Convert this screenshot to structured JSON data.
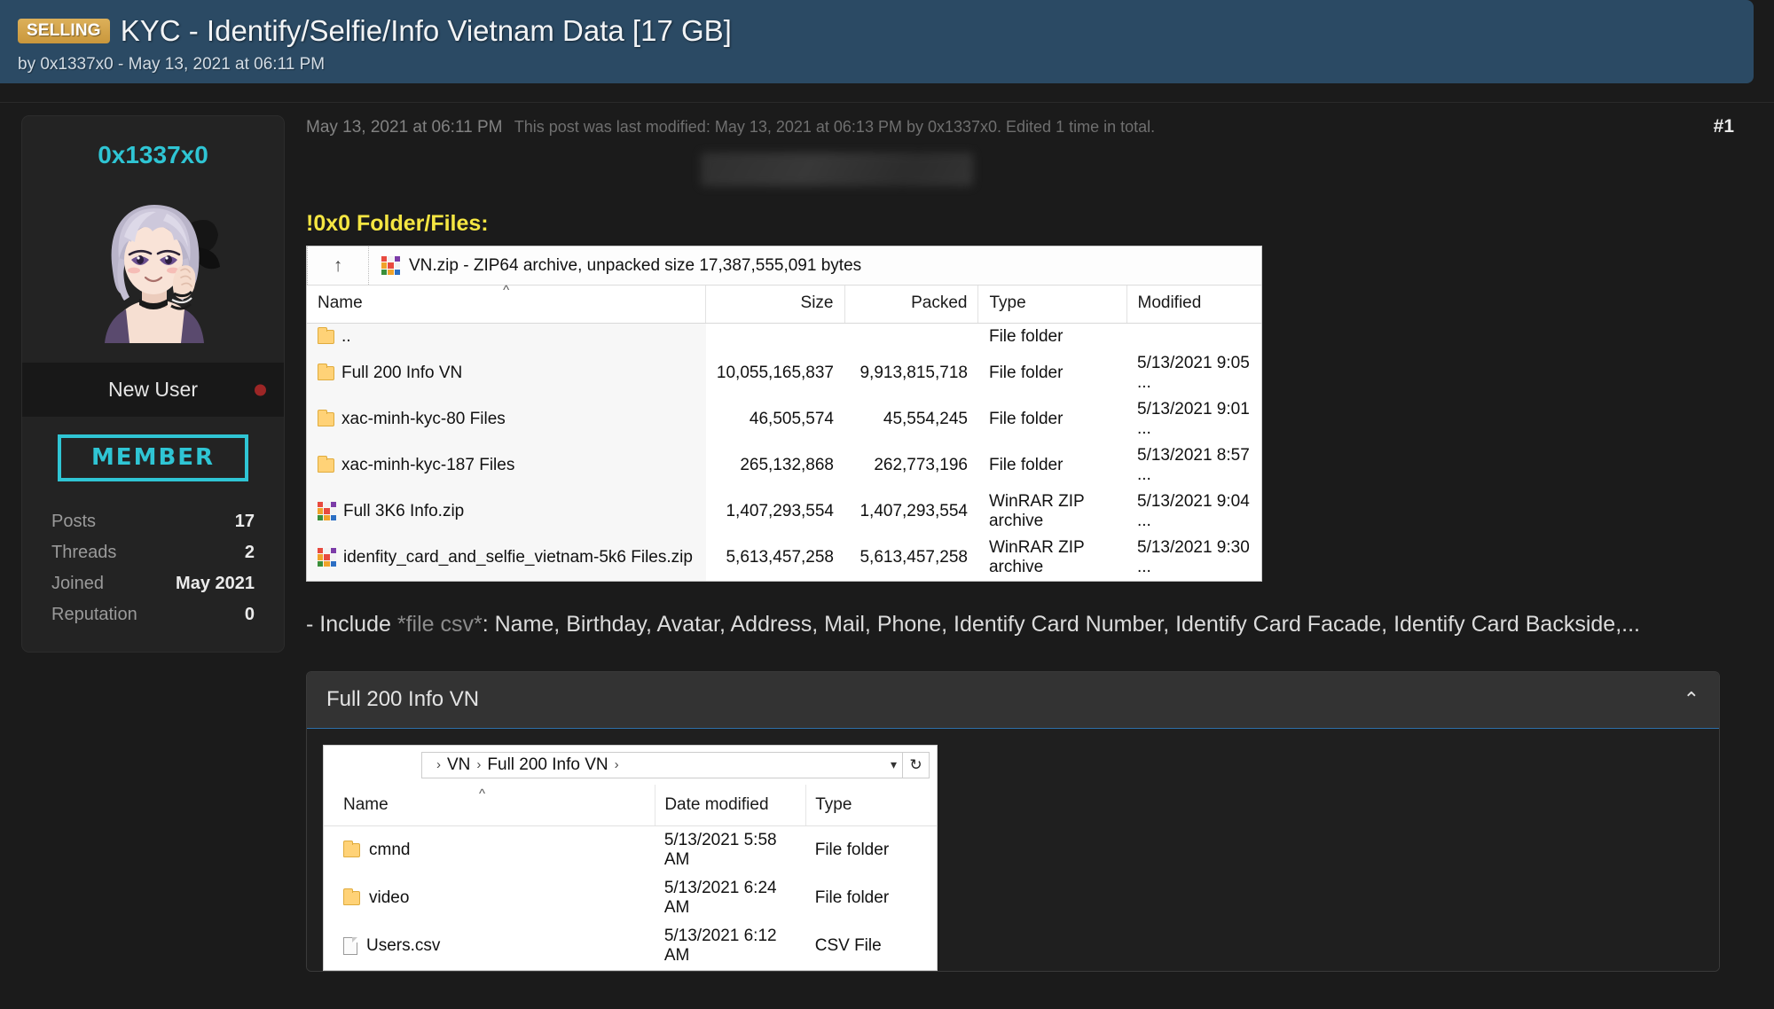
{
  "thread": {
    "badge": "SELLING",
    "title": "KYC - Identify/Selfie/Info Vietnam Data [17 GB]",
    "byline": "by 0x1337x0 - May 13, 2021 at 06:11 PM"
  },
  "author": {
    "username": "0x1337x0",
    "rank": "New User",
    "member_badge": "MEMBER",
    "stats": [
      {
        "label": "Posts",
        "value": "17"
      },
      {
        "label": "Threads",
        "value": "2"
      },
      {
        "label": "Joined",
        "value": "May 2021"
      },
      {
        "label": "Reputation",
        "value": "0"
      }
    ]
  },
  "post": {
    "date": "May 13, 2021 at 06:11 PM",
    "edited_note": "This post was last modified: May 13, 2021 at 06:13 PM by 0x1337x0. Edited 1 time in total.",
    "number": "#1",
    "heading": "!0x0 Folder/Files:",
    "paragraph_prefix": "- Include ",
    "paragraph_emphasis": "*file csv*",
    "paragraph_rest": ": Name, Birthday, Avatar, Address, Mail, Phone, Identify Card Number, Identify Card Facade, Identify Card Backside,..."
  },
  "winrar": {
    "archive_line": "VN.zip - ZIP64 archive, unpacked size 17,387,555,091 bytes",
    "up_icon": "up-arrow-icon",
    "columns": [
      "Name",
      "Size",
      "Packed",
      "Type",
      "Modified"
    ],
    "rows": [
      {
        "name": "..",
        "icon": "folder-icon",
        "size": "",
        "packed": "",
        "type": "File folder",
        "modified": ""
      },
      {
        "name": "Full 200 Info VN",
        "icon": "folder-icon",
        "size": "10,055,165,837",
        "packed": "9,913,815,718",
        "type": "File folder",
        "modified": "5/13/2021 9:05 ..."
      },
      {
        "name": "xac-minh-kyc-80 Files",
        "icon": "folder-icon",
        "size": "46,505,574",
        "packed": "45,554,245",
        "type": "File folder",
        "modified": "5/13/2021 9:01 ..."
      },
      {
        "name": "xac-minh-kyc-187 Files",
        "icon": "folder-icon",
        "size": "265,132,868",
        "packed": "262,773,196",
        "type": "File folder",
        "modified": "5/13/2021 8:57 ..."
      },
      {
        "name": "Full 3K6 Info.zip",
        "icon": "winrar-icon",
        "size": "1,407,293,554",
        "packed": "1,407,293,554",
        "type": "WinRAR ZIP archive",
        "modified": "5/13/2021 9:04 ..."
      },
      {
        "name": "idenfity_card_and_selfie_vietnam-5k6 Files.zip",
        "icon": "winrar-icon",
        "size": "5,613,457,258",
        "packed": "5,613,457,258",
        "type": "WinRAR ZIP archive",
        "modified": "5/13/2021 9:30 ..."
      }
    ]
  },
  "spoiler": {
    "title": "Full 200 Info VN",
    "chevron": "⌃"
  },
  "explorer": {
    "breadcrumbs": [
      "VN",
      "Full 200 Info VN"
    ],
    "dropdown_icon": "chevron-down-icon",
    "refresh_icon": "refresh-icon",
    "columns": [
      "Name",
      "Date modified",
      "Type"
    ],
    "rows": [
      {
        "name": "cmnd",
        "icon": "folder-icon",
        "date": "5/13/2021 5:58 AM",
        "type": "File folder"
      },
      {
        "name": "video",
        "icon": "folder-icon",
        "date": "5/13/2021 6:24 AM",
        "type": "File folder"
      },
      {
        "name": "Users.csv",
        "icon": "file-icon",
        "date": "5/13/2021 6:12 AM",
        "type": "CSV File"
      }
    ]
  },
  "colors": {
    "header_bg": "#2b4a64",
    "badge_bg": "#d4a645",
    "accent_cyan": "#2fc5d4",
    "heading_yellow": "#f5e642",
    "page_bg": "#1b1b1b"
  }
}
